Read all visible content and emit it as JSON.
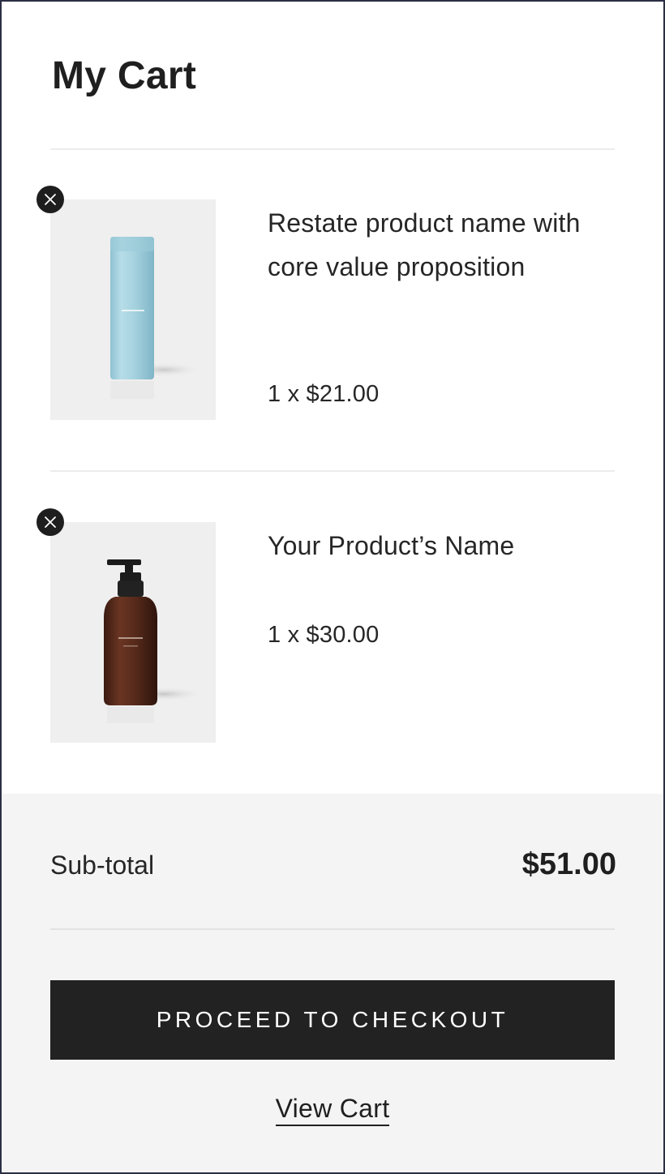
{
  "header": {
    "title": "My Cart"
  },
  "cart": {
    "items": [
      {
        "name": "Restate product name with core value proposition",
        "quantity_price": "1 x $21.00",
        "image": "blue-bottle-product-image",
        "remove_icon": "close-icon"
      },
      {
        "name": "Your Product’s Name",
        "quantity_price": "1 x $30.00",
        "image": "amber-pump-bottle-product-image",
        "remove_icon": "close-icon"
      }
    ]
  },
  "summary": {
    "subtotal_label": "Sub-total",
    "subtotal_value": "$51.00"
  },
  "actions": {
    "checkout_label": "PROCEED TO CHECKOUT",
    "view_cart_label": "View Cart"
  },
  "colors": {
    "button_background": "#222222",
    "footer_background": "#f4f4f4",
    "image_background": "#efefef",
    "text": "#1f1f1f"
  }
}
